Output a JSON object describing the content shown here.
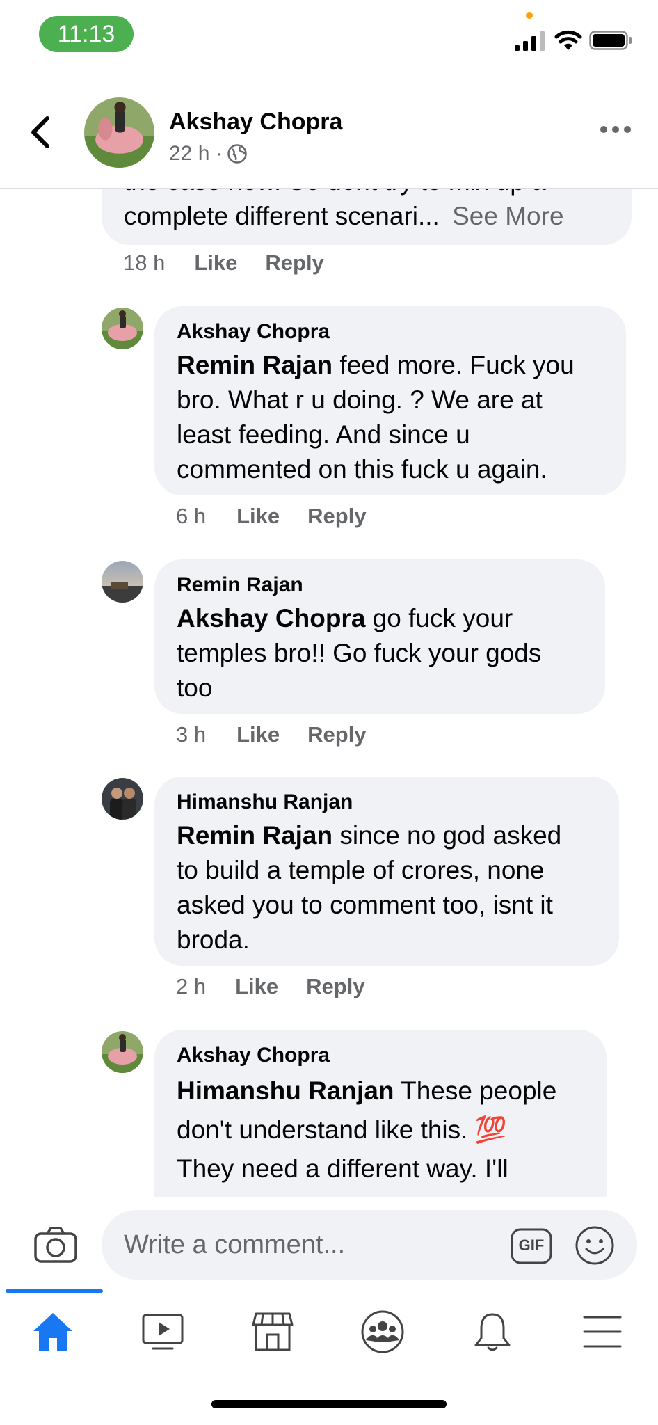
{
  "status_bar": {
    "time": "11:13"
  },
  "header": {
    "name": "Akshay Chopra",
    "meta": "22 h ·"
  },
  "partial_comment": {
    "line_cut": "the case now.  So dont try to mix up a",
    "line_text": "complete different scenari...",
    "see_more": "See More",
    "time": "18 h",
    "like": "Like",
    "reply": "Reply"
  },
  "comments": [
    {
      "author": "Akshay Chopra",
      "mention": "Remin Rajan",
      "lines": [
        " feed more. Fuck you",
        "bro. What r u doing. ? We are at",
        "least feeding. And since u",
        "commented on this fuck u again."
      ],
      "time": "6 h",
      "like": "Like",
      "reply": "Reply"
    },
    {
      "author": "Remin Rajan",
      "mention": "Akshay Chopra",
      "lines": [
        " go fuck your",
        "temples bro!! Go fuck your gods",
        "too"
      ],
      "time": "3 h",
      "like": "Like",
      "reply": "Reply"
    },
    {
      "author": "Himanshu Ranjan",
      "mention": "Remin Rajan",
      "lines": [
        " since no god asked",
        "to build a temple of crores, none",
        "asked you to comment too, isnt it",
        "broda."
      ],
      "time": "2 h",
      "like": "Like",
      "reply": "Reply"
    },
    {
      "author": "Akshay Chopra",
      "mention": "Himanshu Ranjan",
      "lines": [
        " These people",
        "don't understand like this. 💯",
        "They need a different way. I'll"
      ],
      "emoji": "💯"
    }
  ],
  "composer": {
    "placeholder": "Write a comment...",
    "gif_label": "GIF"
  },
  "nav": {
    "items": [
      "home-icon",
      "video-icon",
      "marketplace-icon",
      "groups-icon",
      "notifications-icon",
      "menu-icon"
    ],
    "active": "home-icon",
    "accent_color": "#1877f2"
  },
  "colors": {
    "bubble": "#f0f2f5",
    "secondary_text": "#65676b",
    "time_pill": "#4caf50"
  }
}
